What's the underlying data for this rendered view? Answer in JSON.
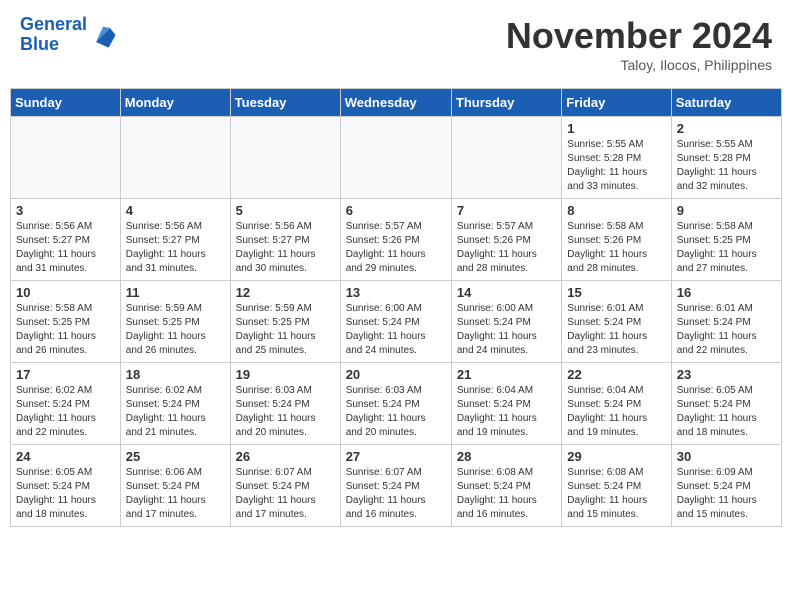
{
  "header": {
    "logo_line1": "General",
    "logo_line2": "Blue",
    "month": "November 2024",
    "location": "Taloy, Ilocos, Philippines"
  },
  "weekdays": [
    "Sunday",
    "Monday",
    "Tuesday",
    "Wednesday",
    "Thursday",
    "Friday",
    "Saturday"
  ],
  "weeks": [
    [
      {
        "day": "",
        "info": ""
      },
      {
        "day": "",
        "info": ""
      },
      {
        "day": "",
        "info": ""
      },
      {
        "day": "",
        "info": ""
      },
      {
        "day": "",
        "info": ""
      },
      {
        "day": "1",
        "info": "Sunrise: 5:55 AM\nSunset: 5:28 PM\nDaylight: 11 hours\nand 33 minutes."
      },
      {
        "day": "2",
        "info": "Sunrise: 5:55 AM\nSunset: 5:28 PM\nDaylight: 11 hours\nand 32 minutes."
      }
    ],
    [
      {
        "day": "3",
        "info": "Sunrise: 5:56 AM\nSunset: 5:27 PM\nDaylight: 11 hours\nand 31 minutes."
      },
      {
        "day": "4",
        "info": "Sunrise: 5:56 AM\nSunset: 5:27 PM\nDaylight: 11 hours\nand 31 minutes."
      },
      {
        "day": "5",
        "info": "Sunrise: 5:56 AM\nSunset: 5:27 PM\nDaylight: 11 hours\nand 30 minutes."
      },
      {
        "day": "6",
        "info": "Sunrise: 5:57 AM\nSunset: 5:26 PM\nDaylight: 11 hours\nand 29 minutes."
      },
      {
        "day": "7",
        "info": "Sunrise: 5:57 AM\nSunset: 5:26 PM\nDaylight: 11 hours\nand 28 minutes."
      },
      {
        "day": "8",
        "info": "Sunrise: 5:58 AM\nSunset: 5:26 PM\nDaylight: 11 hours\nand 28 minutes."
      },
      {
        "day": "9",
        "info": "Sunrise: 5:58 AM\nSunset: 5:25 PM\nDaylight: 11 hours\nand 27 minutes."
      }
    ],
    [
      {
        "day": "10",
        "info": "Sunrise: 5:58 AM\nSunset: 5:25 PM\nDaylight: 11 hours\nand 26 minutes."
      },
      {
        "day": "11",
        "info": "Sunrise: 5:59 AM\nSunset: 5:25 PM\nDaylight: 11 hours\nand 26 minutes."
      },
      {
        "day": "12",
        "info": "Sunrise: 5:59 AM\nSunset: 5:25 PM\nDaylight: 11 hours\nand 25 minutes."
      },
      {
        "day": "13",
        "info": "Sunrise: 6:00 AM\nSunset: 5:24 PM\nDaylight: 11 hours\nand 24 minutes."
      },
      {
        "day": "14",
        "info": "Sunrise: 6:00 AM\nSunset: 5:24 PM\nDaylight: 11 hours\nand 24 minutes."
      },
      {
        "day": "15",
        "info": "Sunrise: 6:01 AM\nSunset: 5:24 PM\nDaylight: 11 hours\nand 23 minutes."
      },
      {
        "day": "16",
        "info": "Sunrise: 6:01 AM\nSunset: 5:24 PM\nDaylight: 11 hours\nand 22 minutes."
      }
    ],
    [
      {
        "day": "17",
        "info": "Sunrise: 6:02 AM\nSunset: 5:24 PM\nDaylight: 11 hours\nand 22 minutes."
      },
      {
        "day": "18",
        "info": "Sunrise: 6:02 AM\nSunset: 5:24 PM\nDaylight: 11 hours\nand 21 minutes."
      },
      {
        "day": "19",
        "info": "Sunrise: 6:03 AM\nSunset: 5:24 PM\nDaylight: 11 hours\nand 20 minutes."
      },
      {
        "day": "20",
        "info": "Sunrise: 6:03 AM\nSunset: 5:24 PM\nDaylight: 11 hours\nand 20 minutes."
      },
      {
        "day": "21",
        "info": "Sunrise: 6:04 AM\nSunset: 5:24 PM\nDaylight: 11 hours\nand 19 minutes."
      },
      {
        "day": "22",
        "info": "Sunrise: 6:04 AM\nSunset: 5:24 PM\nDaylight: 11 hours\nand 19 minutes."
      },
      {
        "day": "23",
        "info": "Sunrise: 6:05 AM\nSunset: 5:24 PM\nDaylight: 11 hours\nand 18 minutes."
      }
    ],
    [
      {
        "day": "24",
        "info": "Sunrise: 6:05 AM\nSunset: 5:24 PM\nDaylight: 11 hours\nand 18 minutes."
      },
      {
        "day": "25",
        "info": "Sunrise: 6:06 AM\nSunset: 5:24 PM\nDaylight: 11 hours\nand 17 minutes."
      },
      {
        "day": "26",
        "info": "Sunrise: 6:07 AM\nSunset: 5:24 PM\nDaylight: 11 hours\nand 17 minutes."
      },
      {
        "day": "27",
        "info": "Sunrise: 6:07 AM\nSunset: 5:24 PM\nDaylight: 11 hours\nand 16 minutes."
      },
      {
        "day": "28",
        "info": "Sunrise: 6:08 AM\nSunset: 5:24 PM\nDaylight: 11 hours\nand 16 minutes."
      },
      {
        "day": "29",
        "info": "Sunrise: 6:08 AM\nSunset: 5:24 PM\nDaylight: 11 hours\nand 15 minutes."
      },
      {
        "day": "30",
        "info": "Sunrise: 6:09 AM\nSunset: 5:24 PM\nDaylight: 11 hours\nand 15 minutes."
      }
    ]
  ]
}
